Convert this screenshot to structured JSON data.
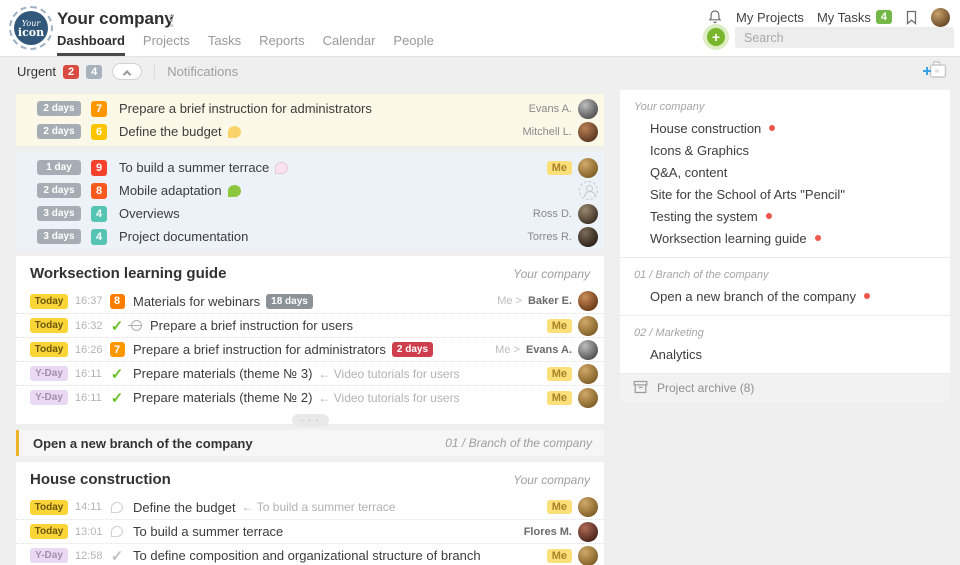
{
  "colors": {
    "accent_green": "#76b82a",
    "urgent_red": "#d94b40",
    "urgent_gray": "#a7b1bc",
    "today_bg": "#fbd535",
    "yday_bg": "#e9d9f3",
    "me_pill_bg": "#fbe07a",
    "project_dot": "#f0564c"
  },
  "glyphs": {
    "check": "✓",
    "plus": "+",
    "more": "· · ·"
  },
  "header": {
    "logo_line1": "Your",
    "logo_line2": "icon",
    "company_name": "Your company",
    "tabs": [
      "Dashboard",
      "Projects",
      "Tasks",
      "Reports",
      "Calendar",
      "People"
    ],
    "active_tab": "Dashboard",
    "my_projects": "My Projects",
    "my_tasks": "My Tasks",
    "my_tasks_count": "4",
    "search_placeholder": "Search"
  },
  "toolbar": {
    "urgent_label": "Urgent",
    "urgent_overdue_count": "2",
    "urgent_upcoming_count": "4",
    "notifications_label": "Notifications"
  },
  "urgent": {
    "overdue_rows": [
      {
        "due": "2 days",
        "priority": "7",
        "priority_color": "#ff9800",
        "title": "Prepare a brief instruction for administrators",
        "who": {
          "name": "Evans A."
        },
        "avatar": {
          "hi": "#bdbdbd",
          "lo": "#454545"
        }
      },
      {
        "due": "2 days",
        "priority": "6",
        "priority_color": "#fdc500",
        "title": "Define the budget",
        "bubble": {
          "fill": "#fbd36b"
        },
        "who": {
          "name": "Mitchell L."
        },
        "avatar": {
          "hi": "#b97f55",
          "lo": "#50301c"
        }
      }
    ],
    "upcoming_rows": [
      {
        "due": "1 day",
        "priority": "9",
        "priority_color": "#f6412d",
        "title": "To build a summer terrace",
        "bubble": {
          "fill": "#f9e3f1",
          "border": "#e9c6dd"
        },
        "who": {
          "me": "Me"
        },
        "avatar": {
          "hi": "#d1a968",
          "lo": "#77571f"
        }
      },
      {
        "due": "2 days",
        "priority": "8",
        "priority_color": "#fb5a1e",
        "title": "Mobile adaptation",
        "bubble": {
          "fill": "#8dc63f"
        },
        "who": {
          "ghost": true
        }
      },
      {
        "due": "3 days",
        "priority": "4",
        "priority_color": "#56c4b2",
        "title": "Overviews",
        "who": {
          "name": "Ross D."
        },
        "avatar": {
          "hi": "#9b8871",
          "lo": "#32281d"
        }
      },
      {
        "due": "3 days",
        "priority": "4",
        "priority_color": "#56c4b2",
        "title": "Project documentation",
        "who": {
          "name": "Torres R."
        },
        "avatar": {
          "hi": "#7c6a58",
          "lo": "#221a12"
        }
      }
    ]
  },
  "sections": [
    {
      "type": "tasklist",
      "title": "Worksection learning guide",
      "project": "Your company",
      "more_label": "· · ·",
      "rows": [
        {
          "due": "Today",
          "due_style": "today",
          "time": "16:37",
          "status": {
            "kind": "priority",
            "value": "8",
            "color": "#ff7d00"
          },
          "title": "Materials for webinars",
          "tag": {
            "text": "18 days",
            "color": "#8d9297"
          },
          "who": {
            "prefix": "Me >",
            "name": "Baker E."
          },
          "avatar": {
            "hi": "#c98d5a",
            "lo": "#61310f"
          }
        },
        {
          "due": "Today",
          "due_style": "today",
          "time": "16:32",
          "status": {
            "kind": "check-green"
          },
          "icon": "linked",
          "title": "Prepare a brief instruction for users",
          "who": {
            "me": "Me"
          },
          "avatar": {
            "hi": "#d1a968",
            "lo": "#77571f"
          }
        },
        {
          "due": "Today",
          "due_style": "today",
          "time": "16:26",
          "status": {
            "kind": "priority",
            "value": "7",
            "color": "#ff9800"
          },
          "title": "Prepare a brief instruction for administrators",
          "tag": {
            "text": "2 days",
            "color": "#cf3e4d"
          },
          "who": {
            "prefix": "Me >",
            "name": "Evans A."
          },
          "avatar": {
            "hi": "#bdbdbd",
            "lo": "#454545"
          }
        },
        {
          "due": "Y-Day",
          "due_style": "yday",
          "time": "16:11",
          "status": {
            "kind": "check-green"
          },
          "title": "Prepare materials (theme № 3)",
          "suffix": "← Video tutorials for users",
          "who": {
            "me": "Me"
          },
          "avatar": {
            "hi": "#d1a968",
            "lo": "#77571f"
          }
        },
        {
          "due": "Y-Day",
          "due_style": "yday",
          "time": "16:11",
          "status": {
            "kind": "check-green"
          },
          "title": "Prepare materials (theme № 2)",
          "suffix": "← Video tutorials for users",
          "who": {
            "me": "Me"
          },
          "avatar": {
            "hi": "#d1a968",
            "lo": "#77571f"
          }
        }
      ]
    },
    {
      "type": "collapsed",
      "title": "Open a new branch of the company",
      "project": "01 / Branch of the company"
    },
    {
      "type": "tasklist",
      "title": "House construction",
      "project": "Your company",
      "rows": [
        {
          "due": "Today",
          "due_style": "today",
          "time": "14:11",
          "status": {
            "kind": "bubble-outline"
          },
          "title": "Define the budget",
          "suffix": "← To build a summer terrace",
          "who": {
            "me": "Me"
          },
          "avatar": {
            "hi": "#d1a968",
            "lo": "#77571f"
          }
        },
        {
          "due": "Today",
          "due_style": "today",
          "time": "13:01",
          "status": {
            "kind": "bubble-outline"
          },
          "title": "To build a summer terrace",
          "who": {
            "name": "Flores M."
          },
          "avatar": {
            "hi": "#b06a54",
            "lo": "#3f1d16"
          }
        },
        {
          "due": "Y-Day",
          "due_style": "yday",
          "time": "12:58",
          "status": {
            "kind": "check-gray"
          },
          "title": "To define composition and organizational structure of branch",
          "who": {
            "me": "Me"
          },
          "avatar": {
            "hi": "#d1a968",
            "lo": "#77571f"
          }
        }
      ]
    }
  ],
  "sidebar": {
    "groups": [
      {
        "header": "Your company",
        "items": [
          {
            "label": "House construction",
            "dot": true
          },
          {
            "label": "Icons & Graphics"
          },
          {
            "label": "Q&A, content"
          },
          {
            "label": "Site for the School of Arts \"Pencil\""
          },
          {
            "label": "Testing the system",
            "dot": true
          },
          {
            "label": "Worksection learning guide",
            "dot": true
          }
        ]
      },
      {
        "header": "01 / Branch of the company",
        "items": [
          {
            "label": "Open a new branch of the company",
            "dot": true
          }
        ]
      },
      {
        "header": "02 / Marketing",
        "items": [
          {
            "label": "Analytics"
          }
        ]
      }
    ],
    "archive_label": "Project archive (8)"
  }
}
